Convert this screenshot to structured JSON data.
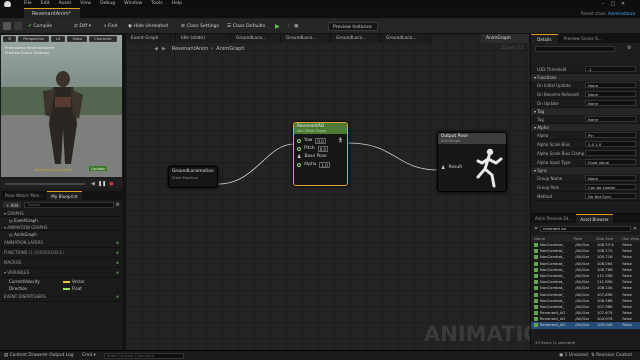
{
  "app": {
    "menu": [
      "File",
      "Edit",
      "Asset",
      "View",
      "Debug",
      "Window",
      "Tools",
      "Help"
    ],
    "document_tab": "RevenantAnim*",
    "parent_class_label": "Parent class:",
    "parent_class_value": "AnimInstance"
  },
  "toolbar": {
    "compile": "Compile",
    "diff": "Diff",
    "find": "Find",
    "hide_unrelated": "Hide Unrelated",
    "class_settings": "Class Settings",
    "class_defaults": "Class Defaults",
    "preview_instance": "Preview Instance"
  },
  "viewport": {
    "perspective": "Perspective",
    "lit": "Lit",
    "show": "Show",
    "character": "Character",
    "overlay_line1": "Previewing RevenantAnim",
    "overlay_line2": "Preview Scene Settings",
    "preview_out_of_date": "Preview out of date",
    "update": "Update",
    "accent": "#d6a52a"
  },
  "my_blueprint": {
    "tabs": [
      "Pose Watch Man...",
      "My Blueprint"
    ],
    "add": "Add",
    "search_placeholder": "Search",
    "sections": {
      "graphs": "GRAPHS",
      "event_graph": "EventGraph",
      "animation_graphs": "ANIMATION GRAPHS",
      "anim_graph": "AnimGraph",
      "animation_layers": "ANIMATION LAYERS",
      "functions": "FUNCTIONS",
      "functions_overridable": "(1 OVERRIDABLE)",
      "macros": "MACROS",
      "variables": "VARIABLES",
      "event_dispatchers": "EVENT DISPATCHERS"
    },
    "variables": [
      {
        "name": "CurrentVelocity",
        "type": "Vector",
        "color": "#e8c43a"
      },
      {
        "name": "Direction",
        "type": "Float",
        "color": "#9ae35a"
      }
    ]
  },
  "graph": {
    "tabs": [
      "Event Graph",
      "Idle (state)",
      "GroundLoco...",
      "GroundLoco...",
      "GroundLoco...",
      "GroundLoco...",
      "AnimGraph"
    ],
    "breadcrumb_root": "RevenantAnim",
    "breadcrumb_leaf": "AnimGraph",
    "zoom": "Zoom 1:1",
    "watermark": "ANIMATION",
    "nodes": {
      "state_machine": {
        "title": "GroundLocomotion",
        "subtitle": "State Machine"
      },
      "aim_offset": {
        "title": "RevenantAO",
        "subtitle": "Aim Offset Player",
        "pins": [
          {
            "label": "Yaw",
            "value": "0.0"
          },
          {
            "label": "Pitch",
            "value": "0.0"
          },
          {
            "label": "Base Pose",
            "value": ""
          },
          {
            "label": "Alpha",
            "value": "1.0"
          }
        ]
      },
      "output_pose": {
        "title": "Output Pose",
        "subtitle": "AnimGraph",
        "pin": "Result"
      }
    }
  },
  "details": {
    "tabs": [
      "Details",
      "Preview Scene S..."
    ],
    "lod_threshold": {
      "label": "LOD Threshold",
      "value": "-1"
    },
    "groups": {
      "functions": "Functions",
      "tag": "Tag",
      "alpha": "Alpha",
      "sync": "Sync"
    },
    "function_rows": [
      {
        "label": "On Initial Update",
        "value": "None"
      },
      {
        "label": "On Become Relevant",
        "value": "None"
      },
      {
        "label": "On Update",
        "value": "None"
      }
    ],
    "tag_row": {
      "label": "Tag",
      "value": "None"
    },
    "alpha_rows": [
      {
        "label": "Alpha",
        "value": "Pin"
      },
      {
        "label": "Alpha Scale Bias",
        "value": "0.0    1.0"
      },
      {
        "label": "Alpha Scale Bias Clamp",
        "value": ""
      },
      {
        "label": "Alpha Input Type",
        "value": "Float Value"
      }
    ],
    "sync_rows": [
      {
        "label": "Group Name",
        "value": "None"
      },
      {
        "label": "Group Role",
        "value": "Can be Leader"
      },
      {
        "label": "Method",
        "value": "Do Not Sync"
      }
    ]
  },
  "asset_browser": {
    "tabs": [
      "Anim Preview Ed...",
      "Asset Browser"
    ],
    "search_value": "revenant ao",
    "columns": [
      "Name",
      "Path",
      "Disk Size",
      "Has Virtu"
    ],
    "rows": [
      {
        "name": "NonCombat_",
        "path": "/All/Gar",
        "size": "108.53 K",
        "virt": "False"
      },
      {
        "name": "NonCombat_",
        "path": "/All/Gar",
        "size": "106.170",
        "virt": "False"
      },
      {
        "name": "NonCombat_",
        "path": "/All/Gar",
        "size": "105.716",
        "virt": "False"
      },
      {
        "name": "NonCombat_",
        "path": "/All/Gar",
        "size": "108.064",
        "virt": "False"
      },
      {
        "name": "NonCombat_",
        "path": "/All/Gar",
        "size": "106.766",
        "virt": "False"
      },
      {
        "name": "NonCombat_",
        "path": "/All/Gar",
        "size": "111.958",
        "virt": "False"
      },
      {
        "name": "NonCombat_",
        "path": "/All/Gar",
        "size": "111.89K",
        "virt": "False"
      },
      {
        "name": "NonCombat_",
        "path": "/All/Gar",
        "size": "108.14K",
        "virt": "False"
      },
      {
        "name": "NonCombat_",
        "path": "/All/Gar",
        "size": "107.89K",
        "virt": "False"
      },
      {
        "name": "NonCombat_",
        "path": "/All/Gar",
        "size": "106.566",
        "virt": "False"
      },
      {
        "name": "NonCombat_",
        "path": "/All/Gar",
        "size": "107.96K",
        "virt": "False"
      },
      {
        "name": "Revenant_AO",
        "path": "/All/Gar",
        "size": "107.674",
        "virt": "False"
      },
      {
        "name": "Revenant_AO",
        "path": "/All/Gar",
        "size": "104.976",
        "virt": "False"
      },
      {
        "name": "Revenant_AO",
        "path": "/All/Gar",
        "size": "105.04K",
        "virt": "False"
      }
    ],
    "footer": "33 items (1 selected)"
  },
  "statusbar": {
    "content_drawer": "Content Drawer",
    "output_log": "Output Log",
    "cmd": "Cmd",
    "console_placeholder": "Enter Console Command",
    "unsaved": "1 Unsaved",
    "revision_control": "Revision Control"
  }
}
